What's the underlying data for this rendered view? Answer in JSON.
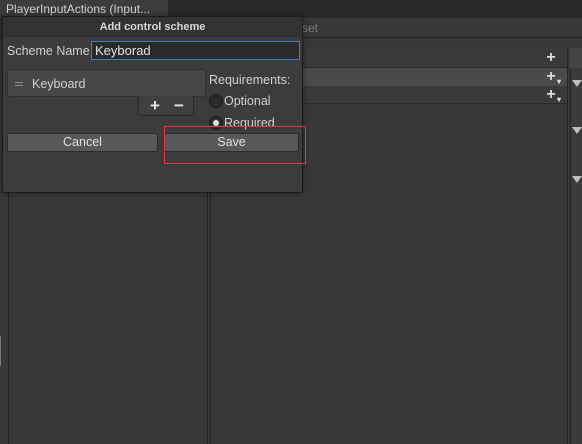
{
  "window": {
    "tab_title": "PlayerInputActions (Input...",
    "toolbar_asset_text": "set"
  },
  "panels": {
    "add_icon": "plus-icon",
    "collapse_icon": "triangle-down-icon"
  },
  "dialog": {
    "title": "Add control scheme",
    "scheme_name_label": "Scheme Name",
    "scheme_name_value": "Keyborad",
    "devices": [
      {
        "label": "Keyboard"
      }
    ],
    "add_device_label": "+",
    "remove_device_label": "−",
    "requirements_label": "Requirements:",
    "optional_label": "Optional",
    "required_label": "Required",
    "selected_requirement": "Required",
    "cancel_label": "Cancel",
    "save_label": "Save"
  },
  "colors": {
    "highlight": "#e0383d",
    "focus_border": "#3d7ccc",
    "background": "#383838"
  }
}
